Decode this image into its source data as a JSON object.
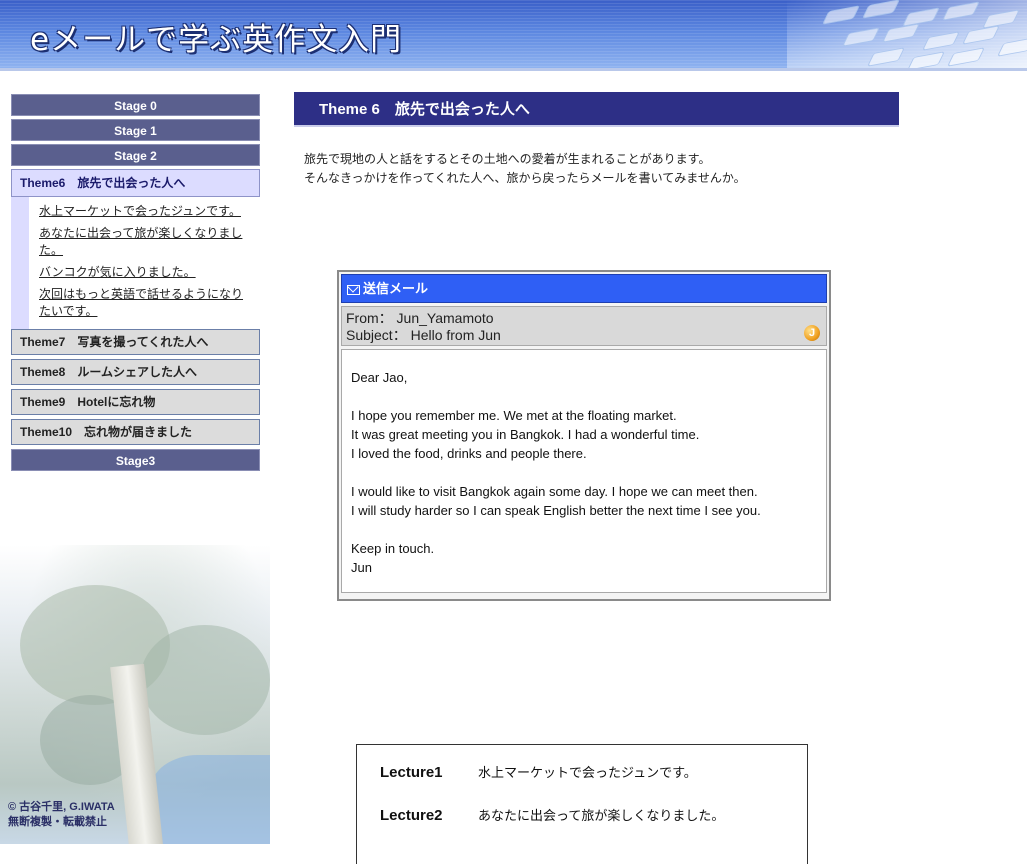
{
  "header": {
    "title": "eメールで学ぶ英作文入門"
  },
  "sidebar": {
    "stages_top": [
      "Stage 0",
      "Stage 1",
      "Stage 2"
    ],
    "active_theme": "Theme6　旅先で出会った人へ",
    "lectures": [
      "水上マーケットで会ったジュンです。",
      "あなたに出会って旅が楽しくなりました。",
      "バンコクが気に入りました。",
      "次回はもっと英語で話せるようになりたいです。"
    ],
    "themes": [
      "Theme7　写真を撮ってくれた人へ",
      "Theme8　ルームシェアした人へ",
      "Theme9　Hotelに忘れ物",
      "Theme10　忘れ物が届きました"
    ],
    "stage_bottom": "Stage3",
    "copyright_line1": "© 古谷千里, G.IWATA",
    "copyright_line2": "無断複製・転載禁止"
  },
  "main": {
    "heading": "Theme 6　旅先で出会った人へ",
    "intro": [
      "旅先で現地の人と話をするとその土地への愛着が生まれることがあります。",
      "そんなきっかけを作ってくれた人へ、旅から戻ったらメールを書いてみませんか。"
    ]
  },
  "email": {
    "titlebar": "送信メール",
    "from": "From： Jun_Yamamoto",
    "subject": "Subject： Hello from Jun",
    "avatar_letter": "J",
    "body": {
      "greeting": "Dear Jao,",
      "para1": [
        "I hope you remember me. We met at the floating market.",
        "It was great meeting you in Bangkok. I had a wonderful time.",
        "I loved the food, drinks and people there."
      ],
      "para2": [
        "I would like to visit Bangkok again some day. I hope we can meet then.",
        "I will study harder so I can speak English better the next time I see you."
      ],
      "closing": "Keep in touch.",
      "signature": "Jun"
    }
  },
  "lecture_list": [
    {
      "label": "Lecture1",
      "title": "水上マーケットで会ったジュンです。"
    },
    {
      "label": "Lecture2",
      "title": "あなたに出会って旅が楽しくなりました。"
    }
  ]
}
